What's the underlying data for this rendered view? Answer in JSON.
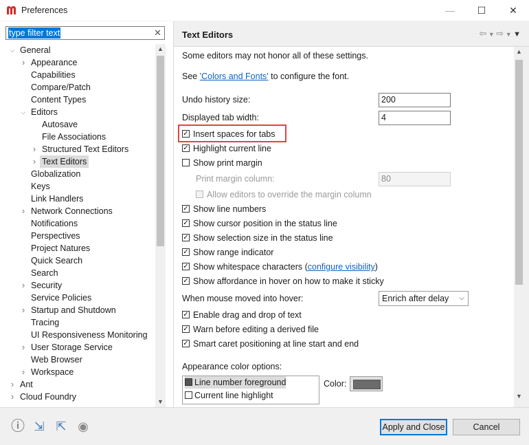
{
  "window": {
    "title": "Preferences",
    "controls": [
      "—",
      "☐",
      "✕"
    ]
  },
  "filter": {
    "placeholder": "type filter text",
    "clear": "✕"
  },
  "tree": [
    {
      "label": "General",
      "level": 0,
      "expanded": true
    },
    {
      "label": "Appearance",
      "level": 1,
      "collapsed": true
    },
    {
      "label": "Capabilities",
      "level": 1
    },
    {
      "label": "Compare/Patch",
      "level": 1
    },
    {
      "label": "Content Types",
      "level": 1
    },
    {
      "label": "Editors",
      "level": 1,
      "expanded": true
    },
    {
      "label": "Autosave",
      "level": 2
    },
    {
      "label": "File Associations",
      "level": 2
    },
    {
      "label": "Structured Text Editors",
      "level": 2,
      "collapsed": true
    },
    {
      "label": "Text Editors",
      "level": 2,
      "collapsed": true,
      "selected": true
    },
    {
      "label": "Globalization",
      "level": 1
    },
    {
      "label": "Keys",
      "level": 1
    },
    {
      "label": "Link Handlers",
      "level": 1
    },
    {
      "label": "Network Connections",
      "level": 1,
      "collapsed": true
    },
    {
      "label": "Notifications",
      "level": 1
    },
    {
      "label": "Perspectives",
      "level": 1
    },
    {
      "label": "Project Natures",
      "level": 1
    },
    {
      "label": "Quick Search",
      "level": 1
    },
    {
      "label": "Search",
      "level": 1
    },
    {
      "label": "Security",
      "level": 1,
      "collapsed": true
    },
    {
      "label": "Service Policies",
      "level": 1
    },
    {
      "label": "Startup and Shutdown",
      "level": 1,
      "collapsed": true
    },
    {
      "label": "Tracing",
      "level": 1
    },
    {
      "label": "UI Responsiveness Monitoring",
      "level": 1
    },
    {
      "label": "User Storage Service",
      "level": 1,
      "collapsed": true
    },
    {
      "label": "Web Browser",
      "level": 1
    },
    {
      "label": "Workspace",
      "level": 1,
      "collapsed": true
    },
    {
      "label": "Ant",
      "level": 0,
      "collapsed": true
    },
    {
      "label": "Cloud Foundry",
      "level": 0,
      "collapsed": true
    }
  ],
  "page": {
    "title": "Text Editors",
    "note": "Some editors may not honor all of these settings.",
    "see_prefix": "See ",
    "colors_link": "'Colors and Fonts'",
    "see_suffix": " to configure the font.",
    "undo_label": "Undo history size:",
    "undo_value": "200",
    "tab_label": "Displayed tab width:",
    "tab_value": "4",
    "print_margin_label": "Print margin column:",
    "print_margin_value": "80",
    "checkboxes": [
      {
        "label": "Insert spaces for tabs",
        "checked": true
      },
      {
        "label": "Highlight current line",
        "checked": true
      },
      {
        "label": "Show print margin",
        "checked": false
      },
      {
        "label": "Allow editors to override the margin column",
        "checked": false,
        "disabled": true
      },
      {
        "label": "Show line numbers",
        "checked": true
      },
      {
        "label": "Show cursor position in the status line",
        "checked": true
      },
      {
        "label": "Show selection size in the status line",
        "checked": true
      },
      {
        "label": "Show range indicator",
        "checked": true
      },
      {
        "label": "Show whitespace characters",
        "checked": true
      },
      {
        "label": "Show affordance in hover on how to make it sticky",
        "checked": true
      },
      {
        "label": "Enable drag and drop of text",
        "checked": true
      },
      {
        "label": "Warn before editing a derived file",
        "checked": true
      },
      {
        "label": "Smart caret positioning at line start and end",
        "checked": true
      }
    ],
    "whitespace_open": "(",
    "whitespace_link": "configure visibility",
    "whitespace_close": ")",
    "hover_label": "When mouse moved into hover:",
    "hover_value": "Enrich after delay",
    "appearance_label": "Appearance color options:",
    "color_options": [
      {
        "label": "Line number foreground",
        "selected": true,
        "swatch": "#555555"
      },
      {
        "label": "Current line highlight",
        "selected": false,
        "swatch": "#ffffff"
      }
    ],
    "color_label": "Color:",
    "color_value": "#6b6b6b"
  },
  "buttons": {
    "apply_close": "Apply and Close",
    "cancel": "Cancel"
  },
  "colors": {
    "highlight_border": "#e0453f",
    "link": "#0b63c6",
    "selection": "#0078d7",
    "brand": "#d62a2a"
  }
}
